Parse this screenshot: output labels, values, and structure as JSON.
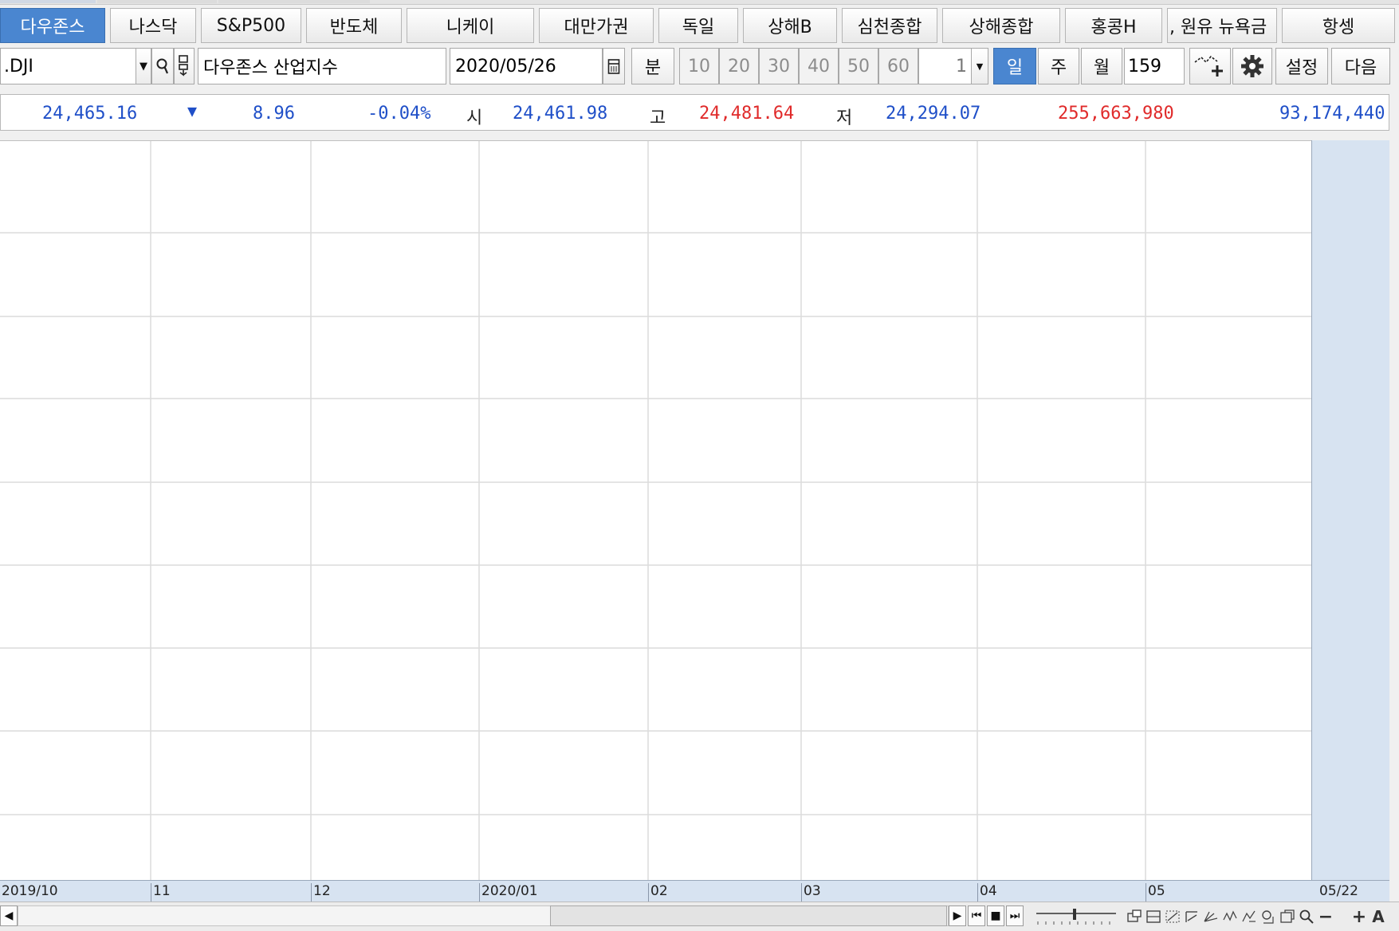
{
  "tabs": [
    {
      "label": "다우존스",
      "active": true
    },
    {
      "label": "나스닥"
    },
    {
      "label": "S&P500"
    },
    {
      "label": "반도체"
    },
    {
      "label": "니케이"
    },
    {
      "label": "대만가권"
    },
    {
      "label": "독일"
    },
    {
      "label": "상해B"
    },
    {
      "label": "심천종합"
    },
    {
      "label": "상해종합"
    },
    {
      "label": "홍콩H"
    },
    {
      "label": ", 원유  뉴욕금"
    },
    {
      "label": "항셍"
    }
  ],
  "toolbar": {
    "symbol": ".DJI",
    "name": "다우존스 산업지수",
    "date": "2020/05/26",
    "minute_label": "분",
    "intervals": [
      "10",
      "20",
      "30",
      "40",
      "50",
      "60"
    ],
    "n_value": "1",
    "day_label": "일",
    "week_label": "주",
    "month_label": "월",
    "count": "159",
    "settings_label": "설정",
    "next_label": "다음",
    "search_icon_glyph": "🔍",
    "gear_icon_glyph": "⚙"
  },
  "quote": {
    "price": "24,465.16",
    "arrow": "▼",
    "change": "8.96",
    "change_pct": "-0.04%",
    "open_label": "시",
    "open": "24,461.98",
    "high_label": "고",
    "high": "24,481.64",
    "low_label": "저",
    "low": "24,294.07",
    "volume": "255,663,980",
    "amount": "93,174,440"
  },
  "xaxis": {
    "ticks": [
      "2019/10",
      "11",
      "12",
      "2020/01",
      "02",
      "03",
      "04",
      "05",
      "05/22"
    ]
  },
  "bottom": {
    "left_arrow": "◀",
    "right_arrow": "▶",
    "first": "⏮",
    "stop": "■",
    "last": "⏭",
    "zoom_search": "🔍",
    "minus": "−",
    "plus": "+",
    "text_tool": "A"
  },
  "colors": {
    "up": "#e02a2a",
    "down": "#1f4fc8",
    "accent": "#4a86d0",
    "axis_bg": "#d7e3f1"
  }
}
